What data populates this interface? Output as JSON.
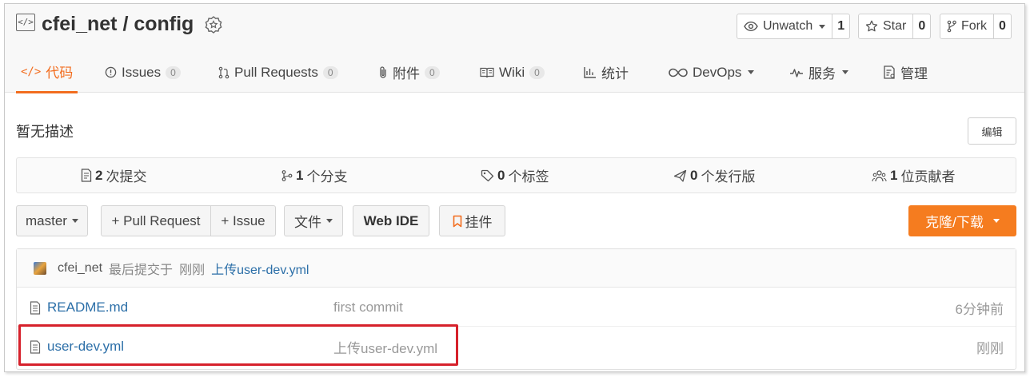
{
  "repo": {
    "owner": "cfei_net",
    "separator": "/",
    "name": "config",
    "icon": "code-repo-icon",
    "badge_icon": "recommend-badge-icon"
  },
  "actions": {
    "unwatch": {
      "label": "Unwatch",
      "count": "1"
    },
    "star": {
      "label": "Star",
      "count": "0"
    },
    "fork": {
      "label": "Fork",
      "count": "0"
    }
  },
  "tabs": [
    {
      "label": "代码",
      "icon": "code-icon",
      "active": true
    },
    {
      "label": "Issues",
      "count": "0",
      "icon": "info-circle-icon"
    },
    {
      "label": "Pull Requests",
      "count": "0",
      "icon": "pull-request-icon"
    },
    {
      "label": "附件",
      "count": "0",
      "icon": "paperclip-icon"
    },
    {
      "label": "Wiki",
      "count": "0",
      "icon": "book-icon"
    },
    {
      "label": "统计",
      "icon": "bar-chart-icon"
    },
    {
      "label": "DevOps",
      "icon": "infinity-icon"
    },
    {
      "label": "服务",
      "icon": "pulse-icon"
    },
    {
      "label": "管理",
      "icon": "settings-doc-icon"
    }
  ],
  "description": "暂无描述",
  "edit_label": "编辑",
  "stats": [
    {
      "count": "2",
      "label": "次提交",
      "icon": "commit-doc-icon"
    },
    {
      "count": "1",
      "label": "个分支",
      "icon": "branch-icon"
    },
    {
      "count": "0",
      "label": "个标签",
      "icon": "tag-icon"
    },
    {
      "count": "0",
      "label": "个发行版",
      "icon": "send-icon"
    },
    {
      "count": "1",
      "label": "位贡献者",
      "icon": "contributors-icon"
    }
  ],
  "toolbar": {
    "branch": "master",
    "pull_request": "+ Pull Request",
    "issue": "+ Issue",
    "files": "文件",
    "web_ide": "Web IDE",
    "pendant": "挂件",
    "clone": "克隆/下载"
  },
  "last_commit": {
    "author": "cfei_net",
    "text": "最后提交于",
    "time": "刚刚",
    "message": "上传user-dev.yml"
  },
  "files": [
    {
      "name": "README.md",
      "message": "first commit",
      "time": "6分钟前"
    },
    {
      "name": "user-dev.yml",
      "message": "上传user-dev.yml",
      "time": "刚刚"
    }
  ],
  "colors": {
    "accent": "#f26d1f",
    "clone_button": "#f57c1f",
    "link": "#2c6fa8",
    "highlight_box": "#d6212b"
  }
}
